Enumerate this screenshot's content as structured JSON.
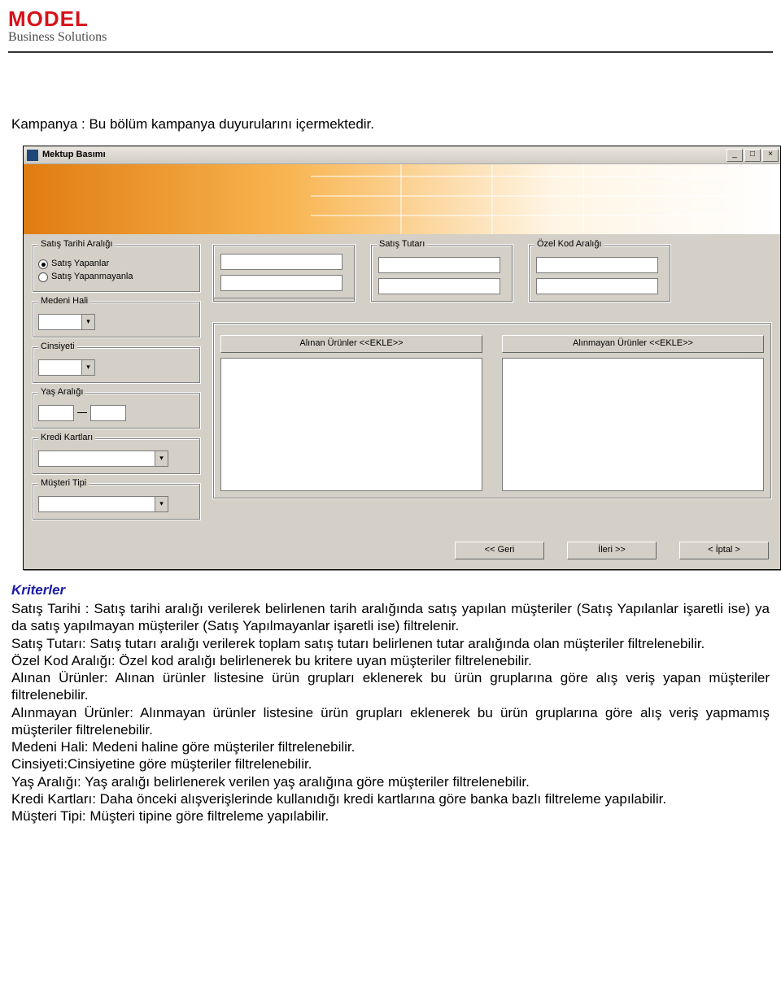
{
  "logo": {
    "line1": "MODEL",
    "line2": "Business Solutions"
  },
  "intro": "Kampanya :  Bu bölüm kampanya duyurularını içermektedir.",
  "window": {
    "title": "Mektup Basımı",
    "min": "_",
    "max": "□",
    "close": "×",
    "groups": {
      "satisTarihi": {
        "legend": "Satış Tarihi Aralığı",
        "opt1": "Satış Yapanlar",
        "opt2": "Satış Yapanmayanla"
      },
      "satisTutari": {
        "legend": "Satış Tutarı"
      },
      "ozelKod": {
        "legend": "Özel Kod Aralığı"
      },
      "medeni": {
        "legend": "Medeni Hali"
      },
      "cinsiyet": {
        "legend": "Cinsiyeti"
      },
      "yas": {
        "legend": "Yaş Aralığı"
      },
      "kredi": {
        "legend": "Kredi Kartları"
      },
      "musteri": {
        "legend": "Müşteri Tipi"
      },
      "alinan": "Alınan Ürünler <<EKLE>>",
      "alinmayan": "Alınmayan Ürünler <<EKLE>>"
    },
    "nav": {
      "back": "<< Geri",
      "next": "İleri >>",
      "cancel": "< İptal >"
    }
  },
  "criteria": {
    "heading": "Kriterler",
    "lines": [
      "Satış Tarihi : Satış tarihi aralığı verilerek belirlenen tarih aralığında satış yapılan müşteriler (Satış Yapılanlar işaretli ise) ya da satış yapılmayan müşteriler (Satış Yapılmayanlar işaretli ise) filtrelenir.",
      "Satış Tutarı: Satış tutarı aralığı verilerek toplam satış tutarı belirlenen tutar aralığında olan müşteriler filtrelenebilir.",
      "Özel Kod Aralığı: Özel kod aralığı belirlenerek bu kritere uyan müşteriler filtrelenebilir.",
      "Alınan Ürünler: Alınan ürünler listesine ürün grupları eklenerek bu ürün gruplarına göre alış veriş yapan müşteriler filtrelenebilir.",
      "Alınmayan Ürünler: Alınmayan ürünler listesine ürün grupları eklenerek bu ürün gruplarına göre alış veriş yapmamış müşteriler filtrelenebilir.",
      "Medeni Hali: Medeni haline göre müşteriler filtrelenebilir.",
      "Cinsiyeti:Cinsiyetine göre müşteriler filtrelenebilir.",
      "Yaş Aralığı: Yaş aralığı belirlenerek verilen yaş aralığına göre müşteriler filtrelenebilir.",
      "Kredi Kartları: Daha önceki alışverişlerinde kullanıdığı kredi kartlarına göre banka bazlı filtreleme yapılabilir.",
      "Müşteri Tipi: Müşteri tipine göre filtreleme yapılabilir."
    ]
  }
}
